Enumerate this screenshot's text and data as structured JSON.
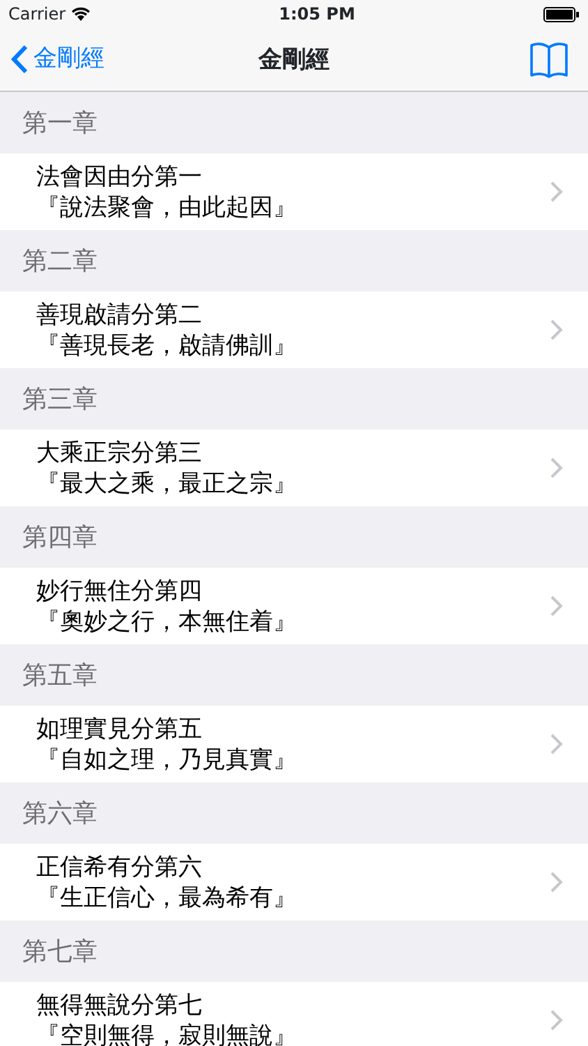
{
  "status_bar": {
    "carrier": "Carrier",
    "time": "1:05 PM"
  },
  "nav": {
    "back_label": "金剛經",
    "title": "金剛經"
  },
  "chapters": [
    {
      "heading": "第一章",
      "title": "法會因由分第一",
      "subtitle": "『說法聚會，由此起因』"
    },
    {
      "heading": "第二章",
      "title": "善現啟請分第二",
      "subtitle": "『善現長老，啟請佛訓』"
    },
    {
      "heading": "第三章",
      "title": "大乘正宗分第三",
      "subtitle": "『最大之乘，最正之宗』"
    },
    {
      "heading": "第四章",
      "title": "妙行無住分第四",
      "subtitle": "『奧妙之行，本無住着』"
    },
    {
      "heading": "第五章",
      "title": "如理實見分第五",
      "subtitle": "『自如之理，乃見真實』"
    },
    {
      "heading": "第六章",
      "title": "正信希有分第六",
      "subtitle": "『生正信心，最為希有』"
    },
    {
      "heading": "第七章",
      "title": "無得無說分第七",
      "subtitle": "『空則無得，寂則無說』"
    }
  ]
}
